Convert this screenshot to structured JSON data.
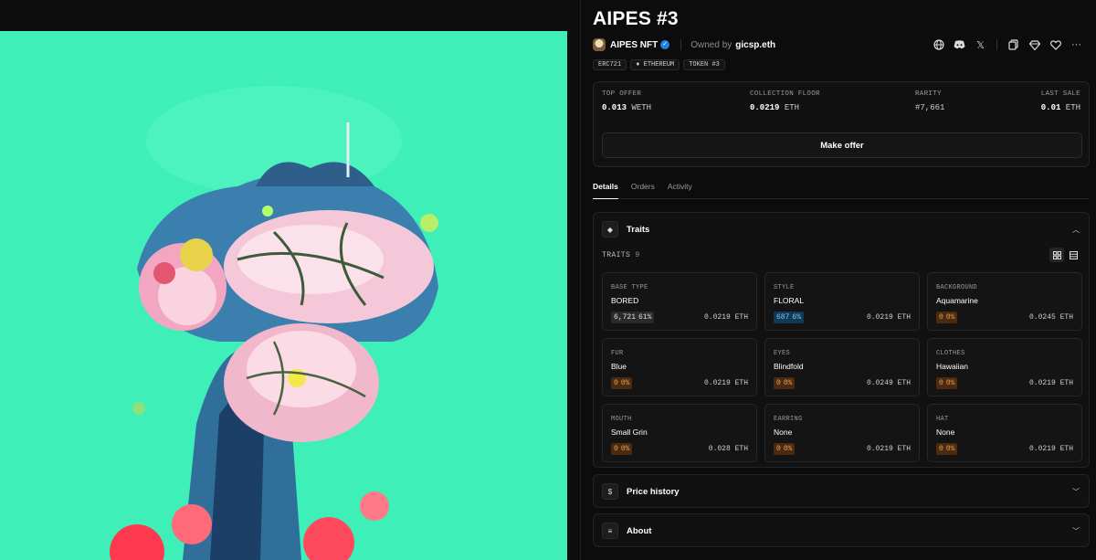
{
  "nft": {
    "title": "AIPES #3",
    "collection_name": "AIPES NFT",
    "owned_by_label": "Owned by",
    "owner": "gicsp.eth"
  },
  "header_icons": [
    "globe-icon",
    "discord-icon",
    "x-icon",
    "copy-icon",
    "diamond-icon",
    "heart-icon",
    "more-icon"
  ],
  "tags": [
    "ERC721",
    "ETHEREUM",
    "TOKEN #3"
  ],
  "stats": {
    "top_offer": {
      "label": "TOP OFFER",
      "value": "0.013",
      "unit": "WETH"
    },
    "collection_floor": {
      "label": "COLLECTION FLOOR",
      "value": "0.0219",
      "unit": "ETH"
    },
    "rarity": {
      "label": "RARITY",
      "value": "#7,661"
    },
    "last_sale": {
      "label": "LAST SALE",
      "value": "0.01",
      "unit": "ETH"
    },
    "make_offer_label": "Make offer"
  },
  "tabs": [
    "Details",
    "Orders",
    "Activity"
  ],
  "traits_section": {
    "title": "Traits",
    "count_label": "TRAITS",
    "count": "9",
    "items": [
      {
        "key": "BASE TYPE",
        "value": "BORED",
        "count": "6,721",
        "pct": "61%",
        "price": "0.0219 ETH",
        "badge_bg": "#2a2a2a",
        "badge_fg": "#e0e0e0"
      },
      {
        "key": "STYLE",
        "value": "FLORAL",
        "count": "687",
        "pct": "6%",
        "price": "0.0219 ETH",
        "badge_bg": "#123a55",
        "badge_fg": "#7cc4ff"
      },
      {
        "key": "BACKGROUND",
        "value": "Aquamarine",
        "count": "0",
        "pct": "0%",
        "price": "0.0245 ETH",
        "badge_bg": "#4a2a10",
        "badge_fg": "#f0a050"
      },
      {
        "key": "FUR",
        "value": "Blue",
        "count": "0",
        "pct": "0%",
        "price": "0.0219 ETH",
        "badge_bg": "#4a2a10",
        "badge_fg": "#f0a050"
      },
      {
        "key": "EYES",
        "value": "Blindfold",
        "count": "0",
        "pct": "0%",
        "price": "0.0249 ETH",
        "badge_bg": "#4a2a10",
        "badge_fg": "#f0a050"
      },
      {
        "key": "CLOTHES",
        "value": "Hawaiian",
        "count": "0",
        "pct": "0%",
        "price": "0.0219 ETH",
        "badge_bg": "#4a2a10",
        "badge_fg": "#f0a050"
      },
      {
        "key": "MOUTH",
        "value": "Small Grin",
        "count": "0",
        "pct": "0%",
        "price": "0.028 ETH",
        "badge_bg": "#4a2a10",
        "badge_fg": "#f0a050"
      },
      {
        "key": "EARRING",
        "value": "None",
        "count": "0",
        "pct": "0%",
        "price": "0.0219 ETH",
        "badge_bg": "#4a2a10",
        "badge_fg": "#f0a050"
      },
      {
        "key": "HAT",
        "value": "None",
        "count": "0",
        "pct": "0%",
        "price": "0.0219 ETH",
        "badge_bg": "#4a2a10",
        "badge_fg": "#f0a050"
      }
    ]
  },
  "price_history": {
    "title": "Price history"
  },
  "about": {
    "title": "About"
  }
}
